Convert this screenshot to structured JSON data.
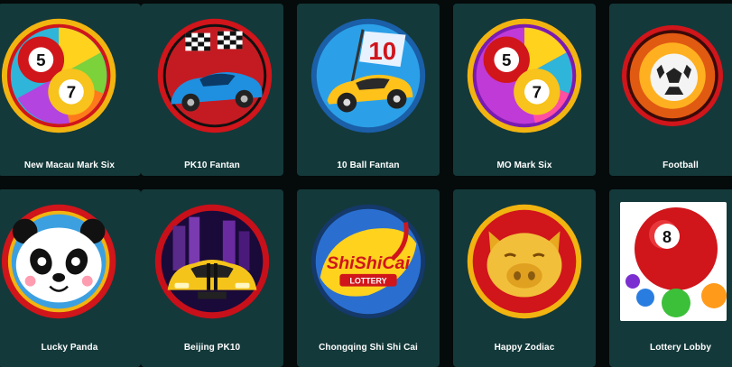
{
  "games": [
    {
      "label": "New Macau Mark Six",
      "icon": "lottery-balls-5-7-icon"
    },
    {
      "label": "PK10 Fantan",
      "icon": "race-car-checkered-flag-icon"
    },
    {
      "label": "10 Ball Fantan",
      "icon": "yellow-car-flag-10-icon"
    },
    {
      "label": "MO Mark Six",
      "icon": "lottery-balls-5-7-purple-icon"
    },
    {
      "label": "Football",
      "icon": "soccer-ball-flames-icon"
    },
    {
      "label": "Lucky Panda",
      "icon": "panda-face-icon"
    },
    {
      "label": "Beijing PK10",
      "icon": "sports-car-city-icon"
    },
    {
      "label": "Chongqing Shi Shi Cai",
      "icon": "shi-shi-cai-logo-icon",
      "logo_text": "ShiShiCai",
      "logo_subtext": "LOTTERY"
    },
    {
      "label": "Happy Zodiac",
      "icon": "golden-pig-icon"
    },
    {
      "label": "Lottery Lobby",
      "icon": "lottery-ball-8-icon",
      "ball_number": "8"
    }
  ],
  "badges": {
    "ball_a": "5",
    "ball_b": "7",
    "flag_number": "10"
  },
  "colors": {
    "tile_bg": "#14393a",
    "page_bg": "#050a0a",
    "label": "#ffffff",
    "ring_red": "#d0151b",
    "ring_gold": "#f2b410"
  }
}
